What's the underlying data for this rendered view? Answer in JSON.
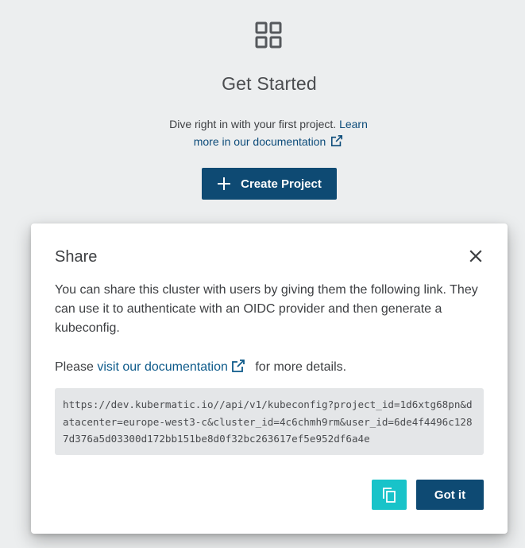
{
  "getstarted": {
    "title": "Get Started",
    "desc_text": "Dive right in with your first project. ",
    "desc_link": "Learn more in our documentation",
    "create_button": "Create Project",
    "icon": "grid-icon"
  },
  "dialog": {
    "title": "Share",
    "body": "You can share this cluster with users by giving them the following link. They can use it to authenticate with an OIDC provider and then generate a kubeconfig.",
    "doc_prefix": "Please ",
    "doc_link": "visit our documentation",
    "doc_suffix": " for more details.",
    "share_link": "https://dev.kubermatic.io//api/v1/kubeconfig?project_id=1d6xtg68pn&datacenter=europe-west3-c&cluster_id=4c6chmh9rm&user_id=6de4f4496c1287d376a5d03300d172bb151be8d0f32bc263617ef5e952df6a4e",
    "copy_icon": "copy-icon",
    "got_it": "Got it"
  },
  "colors": {
    "primary": "#0e4a73",
    "accent": "#18c3c9",
    "background": "#eceeef"
  }
}
